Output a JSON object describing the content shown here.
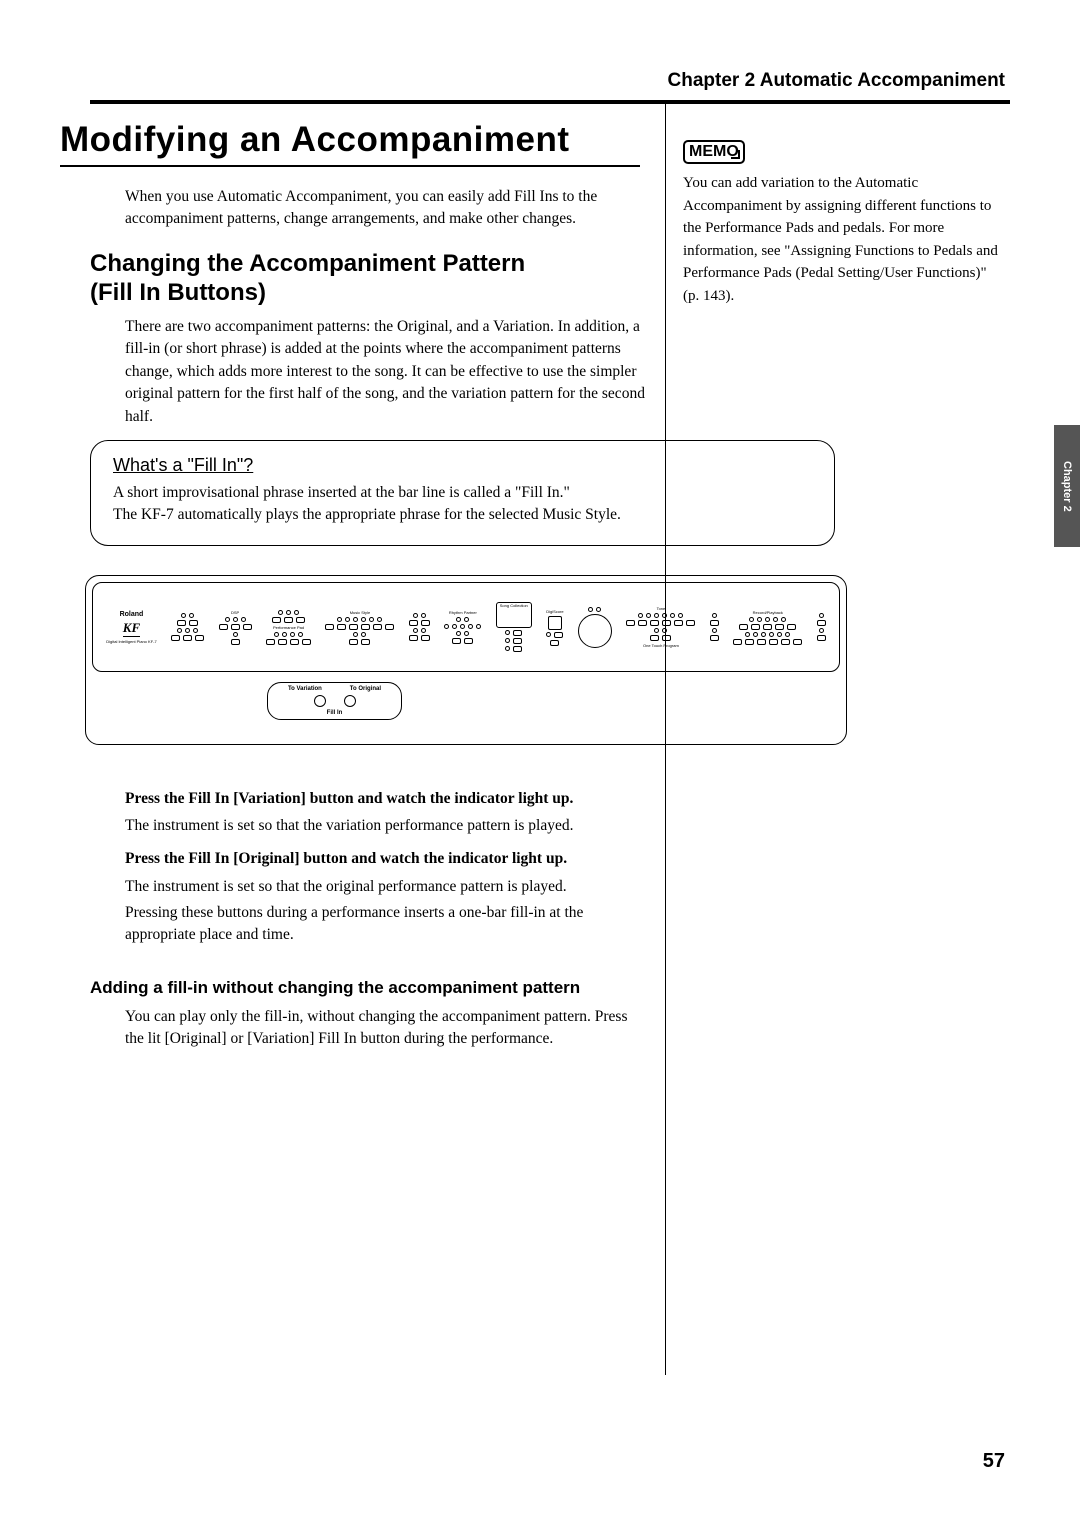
{
  "header": {
    "chapter": "Chapter 2 Automatic Accompaniment"
  },
  "main": {
    "heading": "Modifying an Accompaniment",
    "intro": "When you use Automatic Accompaniment, you can easily add Fill Ins to the accompaniment patterns, change arrangements, and make other changes.",
    "sub_heading_line1": "Changing the Accompaniment Pattern",
    "sub_heading_line2": "(Fill In Buttons)",
    "sub_para": "There are two accompaniment patterns: the Original, and a Variation. In addition, a fill-in (or short phrase) is added at the points where the accompaniment patterns change, which adds more interest to the song. It can be effective to use the simpler original pattern for the first half of the song, and the variation pattern for the second half.",
    "callout_title": "What's a \"Fill In\"?",
    "callout_text1": "A short improvisational phrase inserted at the bar line is called a \"Fill In.\"",
    "callout_text2": "The KF-7 automatically plays the appropriate phrase for the selected Music Style.",
    "panel": {
      "logo_brand": "Roland",
      "logo_model": "KF",
      "logo_sub": "Digital Intelligent Piano KF-7",
      "dsp_label": "DSP",
      "music_style_label": "Music Style",
      "rhythm_label": "Rhythm Partner",
      "song_collection": "Song Collection",
      "perf_pad_label": "Performance Pad",
      "fillin_var": "To Variation",
      "fillin_orig": "To Original",
      "fillin_label": "Fill In",
      "digiscore": "DigiScore",
      "tone_label": "Tone",
      "record_label": "Record/Playback",
      "one_touch": "One Touch Program"
    },
    "step1": "Press the Fill In [Variation] button and watch the indicator light up.",
    "step1_sub": "The instrument is set so that the variation performance pattern is played.",
    "step2": "Press the Fill In [Original] button and watch the indicator light up.",
    "step2_sub": "The instrument is set so that the original performance pattern is played.",
    "step2_sub2": "Pressing these buttons during a performance inserts a one-bar fill-in at the appropriate place and time.",
    "sub_sub_heading": "Adding a fill-in without changing the accompaniment pattern",
    "sub_sub_para": "You can play only the fill-in, without changing the accompaniment pattern. Press the lit [Original] or [Variation] Fill In button during the performance."
  },
  "memo": {
    "label": "MEMO",
    "text": "You can add variation to the Automatic Accompaniment by assigning different functions to the Performance Pads and pedals. For more information, see \"Assigning Functions to Pedals and Performance Pads (Pedal Setting/User Functions)\" (p. 143)."
  },
  "side_tab": "Chapter 2",
  "page_number": "57"
}
